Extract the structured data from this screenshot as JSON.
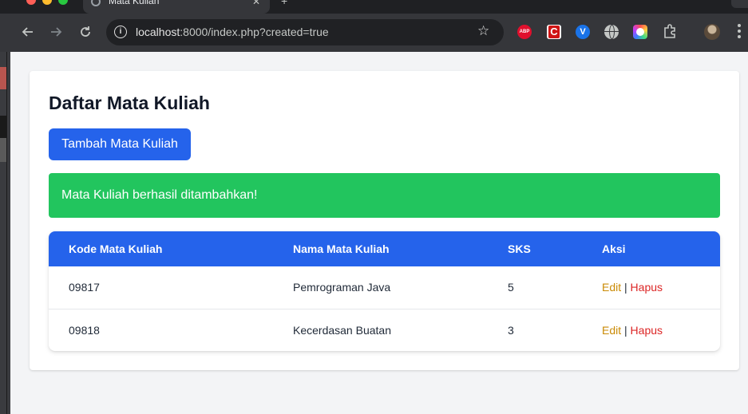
{
  "browser": {
    "tab_title": "Mata Kuliah",
    "tab_close": "✕",
    "new_tab": "+",
    "url_host": "localhost",
    "url_rest": ":8000/index.php?created=true",
    "extensions": [
      "adblock-plus-icon",
      "c-extension-icon",
      "vuejs-devtools-icon",
      "globe-extension-icon",
      "color-picker-extension-icon"
    ],
    "abp_label": "ABP",
    "vue_label": "V"
  },
  "page": {
    "title": "Daftar Mata Kuliah",
    "add_button_label": "Tambah Mata Kuliah",
    "alert_message": "Mata Kuliah berhasil ditambahkan!",
    "colors": {
      "primary": "#2563eb",
      "success": "#22c55e",
      "edit": "#ca8a04",
      "delete": "#dc2626"
    }
  },
  "table": {
    "headers": [
      "Kode Mata Kuliah",
      "Nama Mata Kuliah",
      "SKS",
      "Aksi"
    ],
    "rows": [
      {
        "kode": "09817",
        "nama": "Pemrograman Java",
        "sks": "5",
        "edit": "Edit",
        "sep": "|",
        "hapus": "Hapus"
      },
      {
        "kode": "09818",
        "nama": "Kecerdasan Buatan",
        "sks": "3",
        "edit": "Edit",
        "sep": "|",
        "hapus": "Hapus"
      }
    ]
  }
}
